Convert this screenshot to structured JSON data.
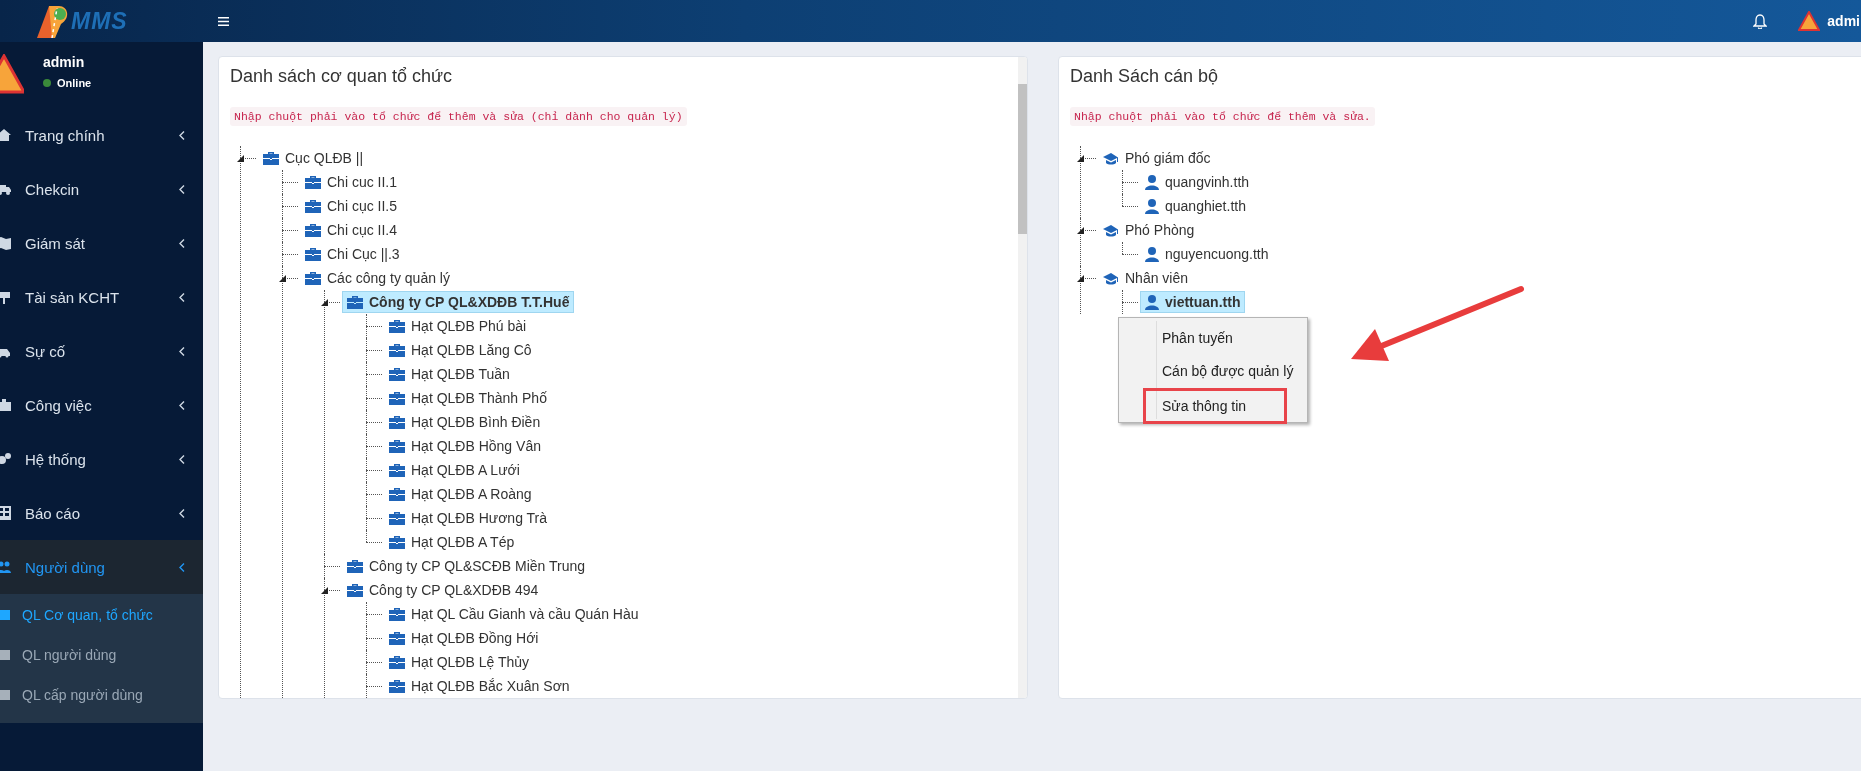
{
  "brand": {
    "logo_text": "MMS"
  },
  "topbar": {
    "user_name": "admi"
  },
  "sidebar": {
    "user": {
      "name": "admin",
      "status": "Online",
      "online": true
    },
    "items": [
      {
        "label": "Trang chính",
        "selected": false
      },
      {
        "label": "Chekcin",
        "selected": false
      },
      {
        "label": "Giám sát",
        "selected": false
      },
      {
        "label": "Tài sản KCHT",
        "selected": false
      },
      {
        "label": "Sự cố",
        "selected": false
      },
      {
        "label": "Công việc",
        "selected": false
      },
      {
        "label": "Hệ thống",
        "selected": false
      },
      {
        "label": "Báo cáo",
        "selected": false
      },
      {
        "label": "Người dùng",
        "selected": true,
        "expanded": true,
        "children": [
          {
            "label": "QL Cơ quan, tổ chức",
            "selected": true
          },
          {
            "label": "QL người dùng",
            "selected": false
          },
          {
            "label": "QL cấp người dùng",
            "selected": false
          }
        ]
      }
    ]
  },
  "left_panel": {
    "title": "Danh sách cơ quan tổ chức",
    "note": "Nhập chuột phải vào tổ chức để thêm và sửa (chỉ dành cho quản lý)",
    "tree": [
      {
        "label": "Cục QLĐB ||",
        "kind": "org",
        "selected": false,
        "expanded": true,
        "children": [
          {
            "label": "Chi cuc II.1",
            "kind": "org",
            "selected": false
          },
          {
            "label": "Chi cục II.5",
            "kind": "org",
            "selected": false
          },
          {
            "label": "Chi cục II.4",
            "kind": "org",
            "selected": false
          },
          {
            "label": "Chi Cục ||.3",
            "kind": "org",
            "selected": false
          },
          {
            "label": "Các công ty quản lý",
            "kind": "org",
            "selected": false,
            "expanded": true,
            "children": [
              {
                "label": "Công ty CP QL&XDĐB T.T.Huế",
                "kind": "org",
                "selected": true,
                "expanded": true,
                "children": [
                  {
                    "label": "Hạt QLĐB Phú bài",
                    "kind": "org",
                    "selected": false
                  },
                  {
                    "label": "Hạt QLĐB Lăng Cô",
                    "kind": "org",
                    "selected": false
                  },
                  {
                    "label": "Hạt QLĐB Tuần",
                    "kind": "org",
                    "selected": false
                  },
                  {
                    "label": "Hạt QLĐB Thành Phố",
                    "kind": "org",
                    "selected": false
                  },
                  {
                    "label": "Hạt QLĐB Bình Điền",
                    "kind": "org",
                    "selected": false
                  },
                  {
                    "label": "Hạt QLĐB Hồng Vân",
                    "kind": "org",
                    "selected": false
                  },
                  {
                    "label": "Hạt QLĐB A Lưới",
                    "kind": "org",
                    "selected": false
                  },
                  {
                    "label": "Hạt QLĐB A Roàng",
                    "kind": "org",
                    "selected": false
                  },
                  {
                    "label": "Hạt QLĐB Hương Trà",
                    "kind": "org",
                    "selected": false
                  },
                  {
                    "label": "Hạt QLĐB A Tép",
                    "kind": "org",
                    "selected": false
                  }
                ]
              },
              {
                "label": "Công ty CP QL&SCĐB Miền Trung",
                "kind": "org",
                "selected": false
              },
              {
                "label": "Công ty CP QL&XDĐB 494",
                "kind": "org",
                "selected": false,
                "expanded": true,
                "children": [
                  {
                    "label": "Hạt QL Cầu Gianh và cầu Quán Hàu",
                    "kind": "org",
                    "selected": false
                  },
                  {
                    "label": "Hạt QLĐB Đồng Hới",
                    "kind": "org",
                    "selected": false
                  },
                  {
                    "label": "Hạt QLĐB Lệ Thủy",
                    "kind": "org",
                    "selected": false
                  },
                  {
                    "label": "Hạt QLĐB Bắc Xuân Sơn",
                    "kind": "org",
                    "selected": false
                  }
                ]
              }
            ]
          }
        ]
      }
    ]
  },
  "right_panel": {
    "title": "Danh Sách cán bộ",
    "note": "Nhập chuột phải vào tổ chức để thêm và sửa.",
    "tree": [
      {
        "label": "Phó giám đốc",
        "kind": "group",
        "selected": false,
        "expanded": true,
        "children": [
          {
            "label": "quangvinh.tth",
            "kind": "user",
            "selected": false
          },
          {
            "label": "quanghiet.tth",
            "kind": "user",
            "selected": false
          }
        ]
      },
      {
        "label": "Phó Phòng",
        "kind": "group",
        "selected": false,
        "expanded": true,
        "children": [
          {
            "label": "nguyencuong.tth",
            "kind": "user",
            "selected": false
          }
        ]
      },
      {
        "label": "Nhân viên",
        "kind": "group",
        "selected": false,
        "expanded": true,
        "children": [
          {
            "label": "viettuan.tth",
            "kind": "user",
            "selected": true
          }
        ]
      }
    ],
    "context_menu": {
      "items": [
        {
          "label": "Phân tuyến",
          "highlighted": false
        },
        {
          "label": "Cán bộ được quản lý",
          "highlighted": false
        },
        {
          "label": "Sửa thông tin",
          "highlighted": true
        }
      ]
    }
  }
}
